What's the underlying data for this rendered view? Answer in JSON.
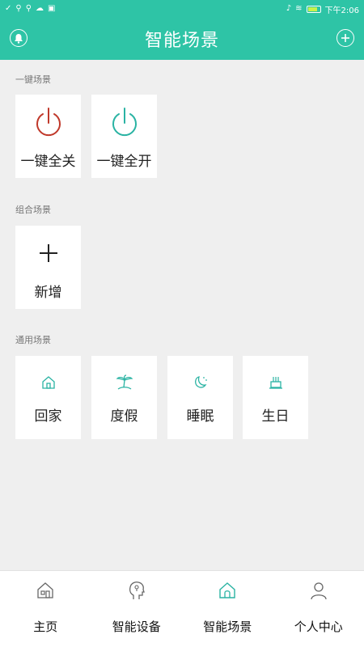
{
  "status_bar": {
    "time": "下午2:06"
  },
  "header": {
    "title": "智能场景",
    "left_icon": "bell-icon",
    "right_icon": "plus-circle-icon"
  },
  "sections": {
    "one_key": {
      "title": "一键场景",
      "items": [
        {
          "label": "一键全关",
          "icon": "power-icon",
          "color": "#c0392b"
        },
        {
          "label": "一键全开",
          "icon": "power-icon",
          "color": "#2ab3a3"
        }
      ]
    },
    "combo": {
      "title": "组合场景",
      "items": [
        {
          "label": "新增",
          "icon": "plus-icon"
        }
      ]
    },
    "common": {
      "title": "通用场景",
      "items": [
        {
          "label": "回家",
          "icon": "home-icon"
        },
        {
          "label": "度假",
          "icon": "palm-tree-icon"
        },
        {
          "label": "睡眠",
          "icon": "moon-icon"
        },
        {
          "label": "生日",
          "icon": "cake-icon"
        }
      ]
    }
  },
  "bottom_nav": [
    {
      "label": "主页",
      "icon": "home-icon",
      "active": false
    },
    {
      "label": "智能设备",
      "icon": "smart-head-icon",
      "active": false
    },
    {
      "label": "智能场景",
      "icon": "scene-home-icon",
      "active": true
    },
    {
      "label": "个人中心",
      "icon": "person-icon",
      "active": false
    }
  ],
  "colors": {
    "accent": "#2ec4a6",
    "icon_teal": "#2ab3a3",
    "off_red": "#c0392b"
  }
}
